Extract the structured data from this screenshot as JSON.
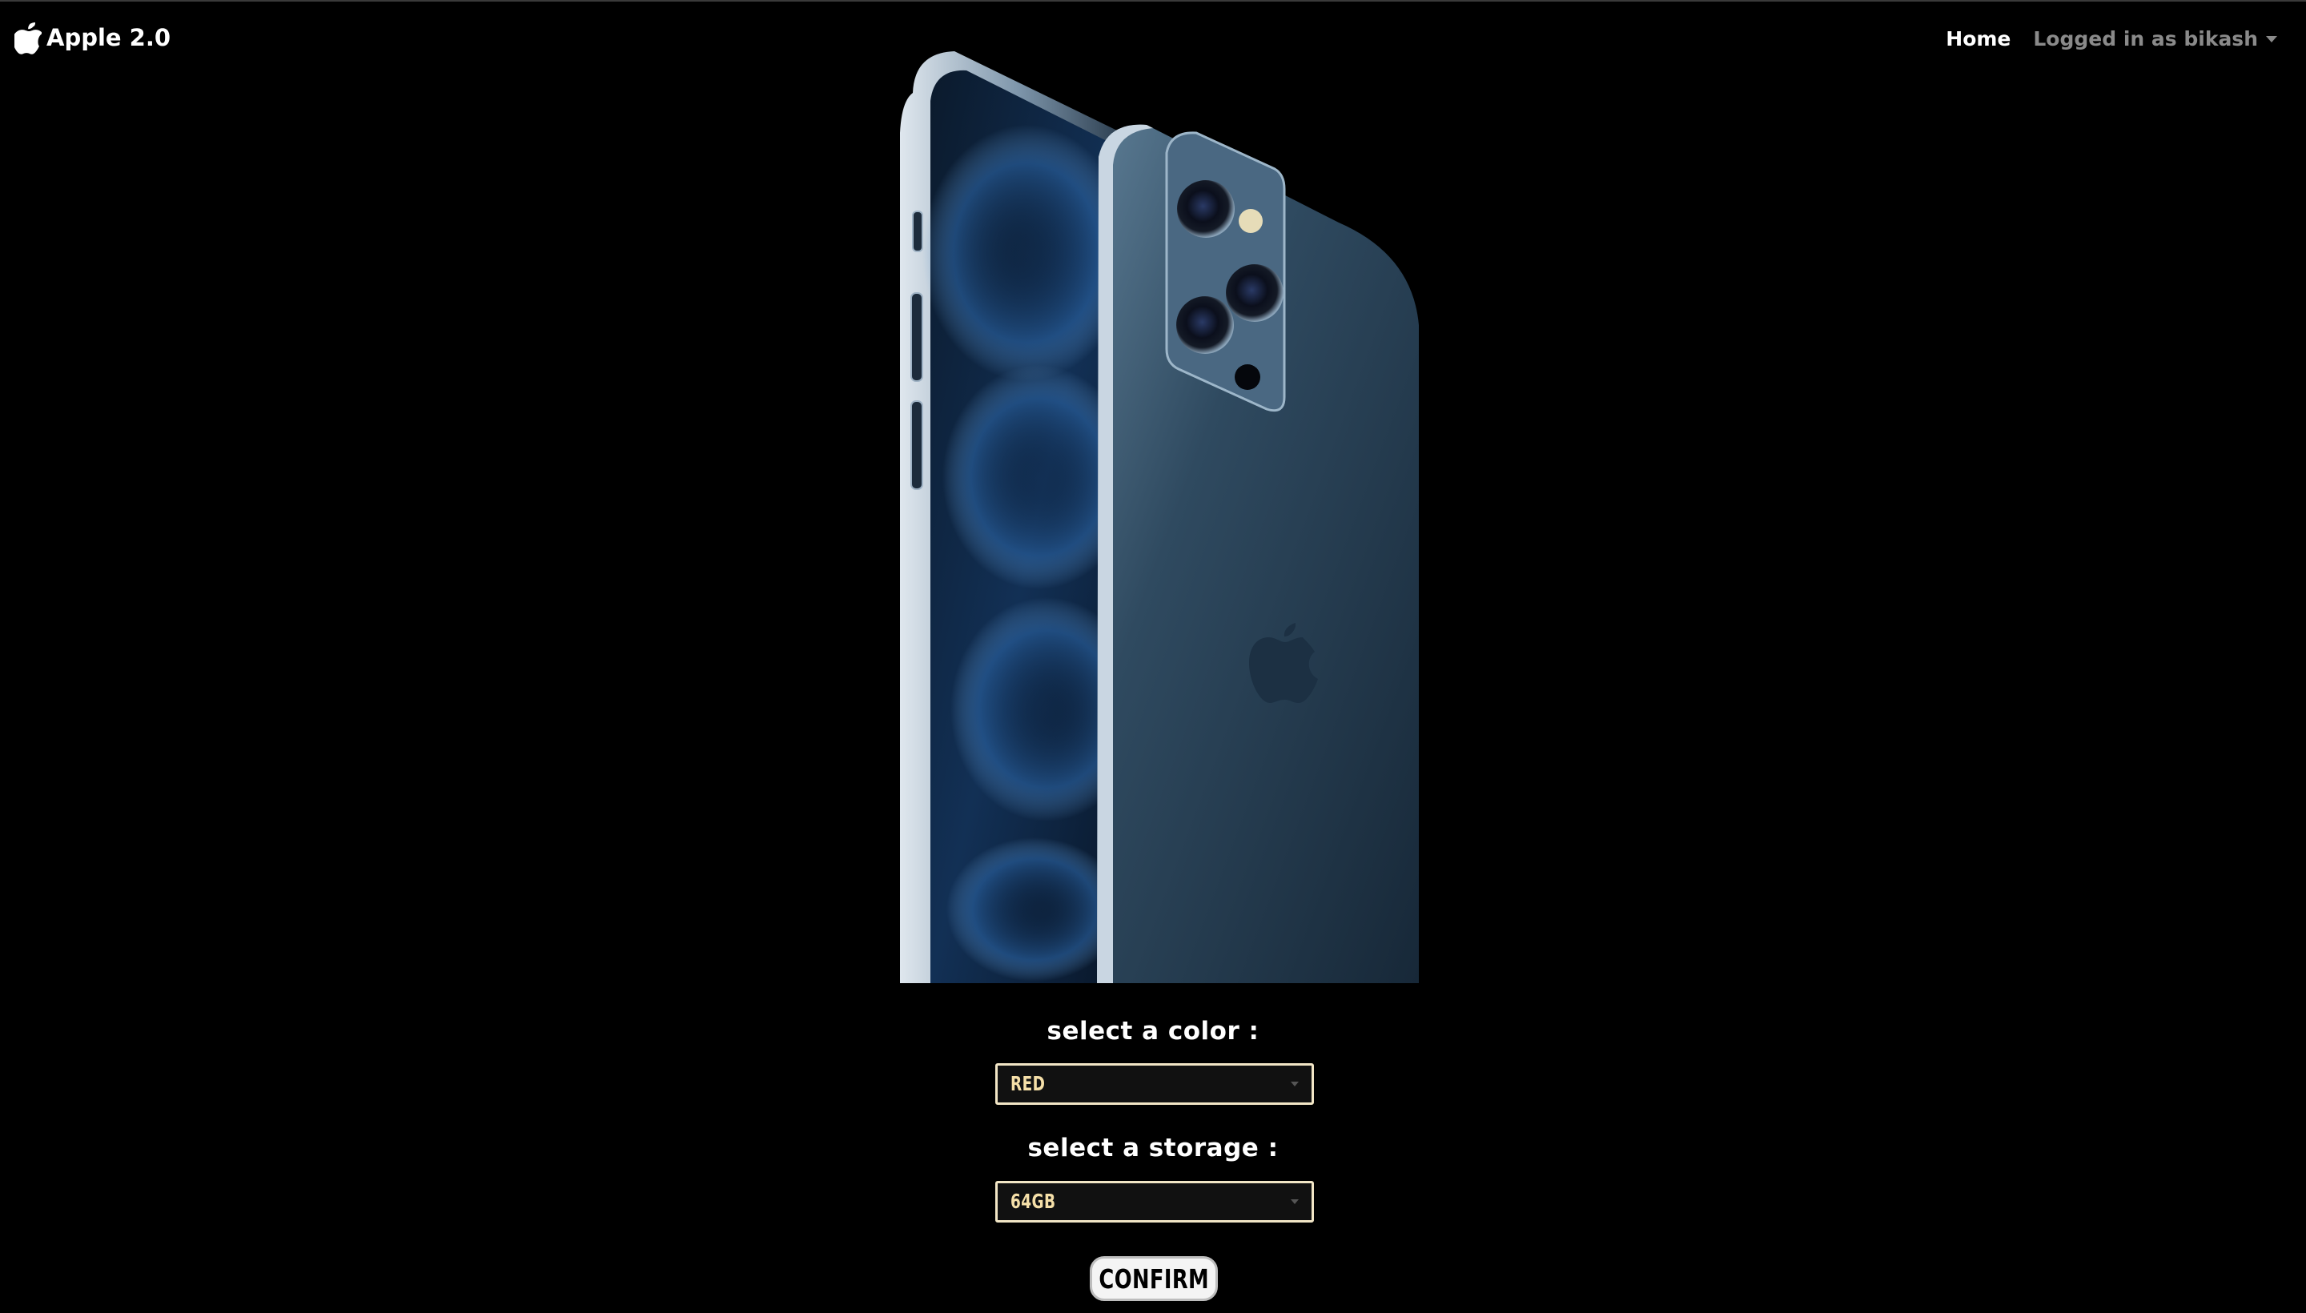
{
  "navbar": {
    "brand": "Apple 2.0",
    "home_label": "Home",
    "user_label": "Logged in as bikash"
  },
  "form": {
    "color_label": "select a color :",
    "color_value": "RED",
    "storage_label": "select a storage :",
    "storage_value": "64GB",
    "confirm_label": "CONFIRM"
  },
  "icons": {
    "brand": "apple-logo-icon",
    "user_menu": "caret-down-icon",
    "select_arrow": "chevron-down-icon"
  },
  "colors": {
    "background": "#000000",
    "select_border": "#f2e6c6",
    "select_text": "#f5dfa8",
    "user_text": "#8a8a8a"
  }
}
